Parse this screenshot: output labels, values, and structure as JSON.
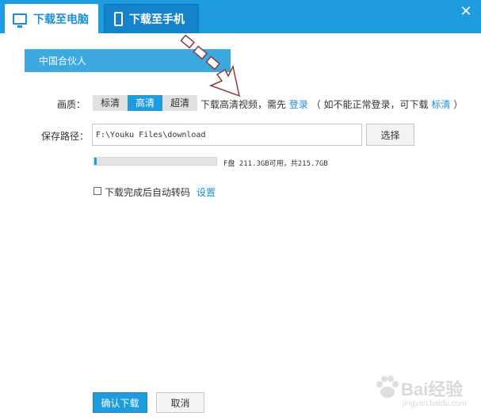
{
  "tabs": [
    {
      "label": "下载至电脑",
      "icon": "monitor-icon",
      "active": true
    },
    {
      "label": "下载至手机",
      "icon": "phone-icon",
      "active": false
    }
  ],
  "close_icon": "✕",
  "partner": {
    "label": "中国合伙人"
  },
  "quality": {
    "label": "画质：",
    "options": [
      "标清",
      "高清",
      "超清"
    ],
    "selected": "高清",
    "hint_prefix": "下载高清视频，需先",
    "login_link": "登录",
    "hint_middle": "（ 如不能正常登录，可下载",
    "alt_link": "标清",
    "hint_suffix": "）"
  },
  "save_path": {
    "label": "保存路径：",
    "value": "F:\\Youku Files\\download",
    "choose_label": "选择"
  },
  "disk": {
    "text": "F盘 211.3GB可用，共215.7GB",
    "used_fraction": 0.02
  },
  "auto_convert": {
    "label": "下载完成后自动转码",
    "settings_link": "设置",
    "checked": false
  },
  "actions": {
    "confirm_label": "确认下载",
    "cancel_label": "取消"
  },
  "watermark": {
    "text": "Bai经验",
    "sub": "jingyan.baidu.com"
  },
  "colors": {
    "accent": "#1d9de0",
    "link": "#1d8fd8"
  }
}
